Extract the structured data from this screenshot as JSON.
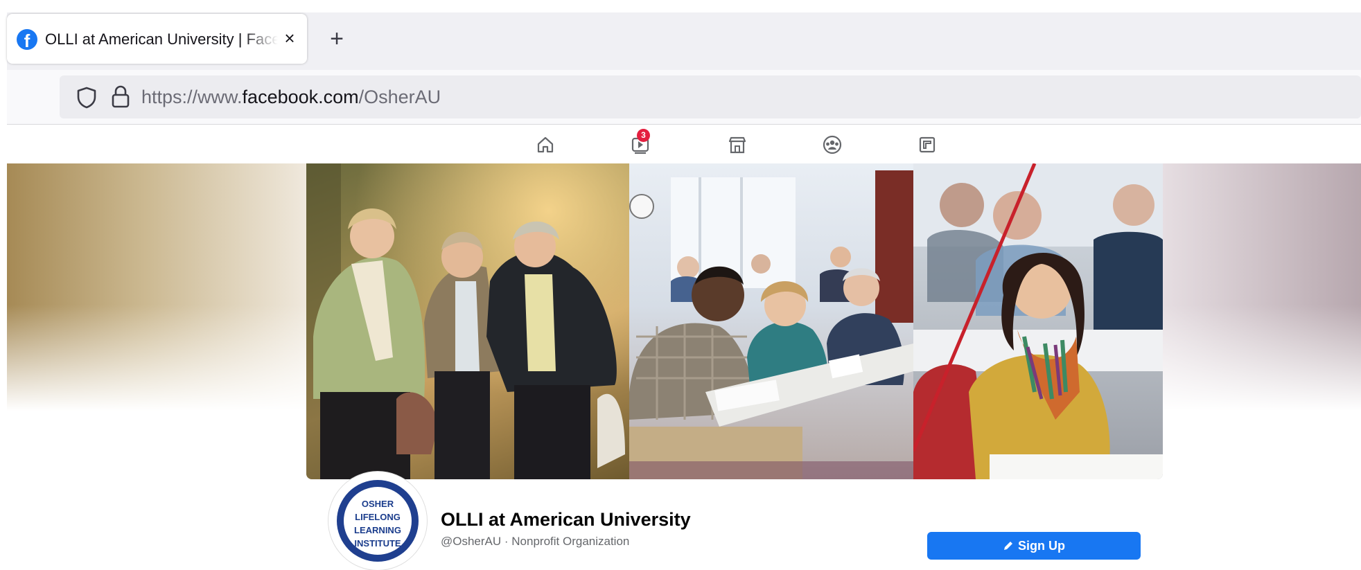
{
  "browser": {
    "tab": {
      "title": "OLLI at American University | Facebook",
      "favicon": "facebook-icon",
      "close_label": "×"
    },
    "new_tab_label": "+",
    "url": {
      "prefix": "https://www.",
      "domain": "facebook.com",
      "path": "/OsherAU"
    }
  },
  "fb_nav": {
    "icons": [
      "home-icon",
      "watch-icon",
      "marketplace-icon",
      "groups-icon",
      "gaming-icon"
    ],
    "watch_badge": "3"
  },
  "cover": {
    "panels": [
      "outdoor-walk-photo",
      "classroom-photo",
      "student-photo"
    ]
  },
  "profile": {
    "logo_lines": [
      "OSHER",
      "LIFELONG",
      "LEARNING",
      "INSTITUTE"
    ],
    "name": "OLLI at American University",
    "handle_category": "@OsherAU · Nonprofit Organization",
    "signup_label": "Sign Up"
  },
  "colors": {
    "facebook_blue": "#1877f2",
    "badge_red": "#e41e3f",
    "logo_navy": "#1f3f8f"
  }
}
